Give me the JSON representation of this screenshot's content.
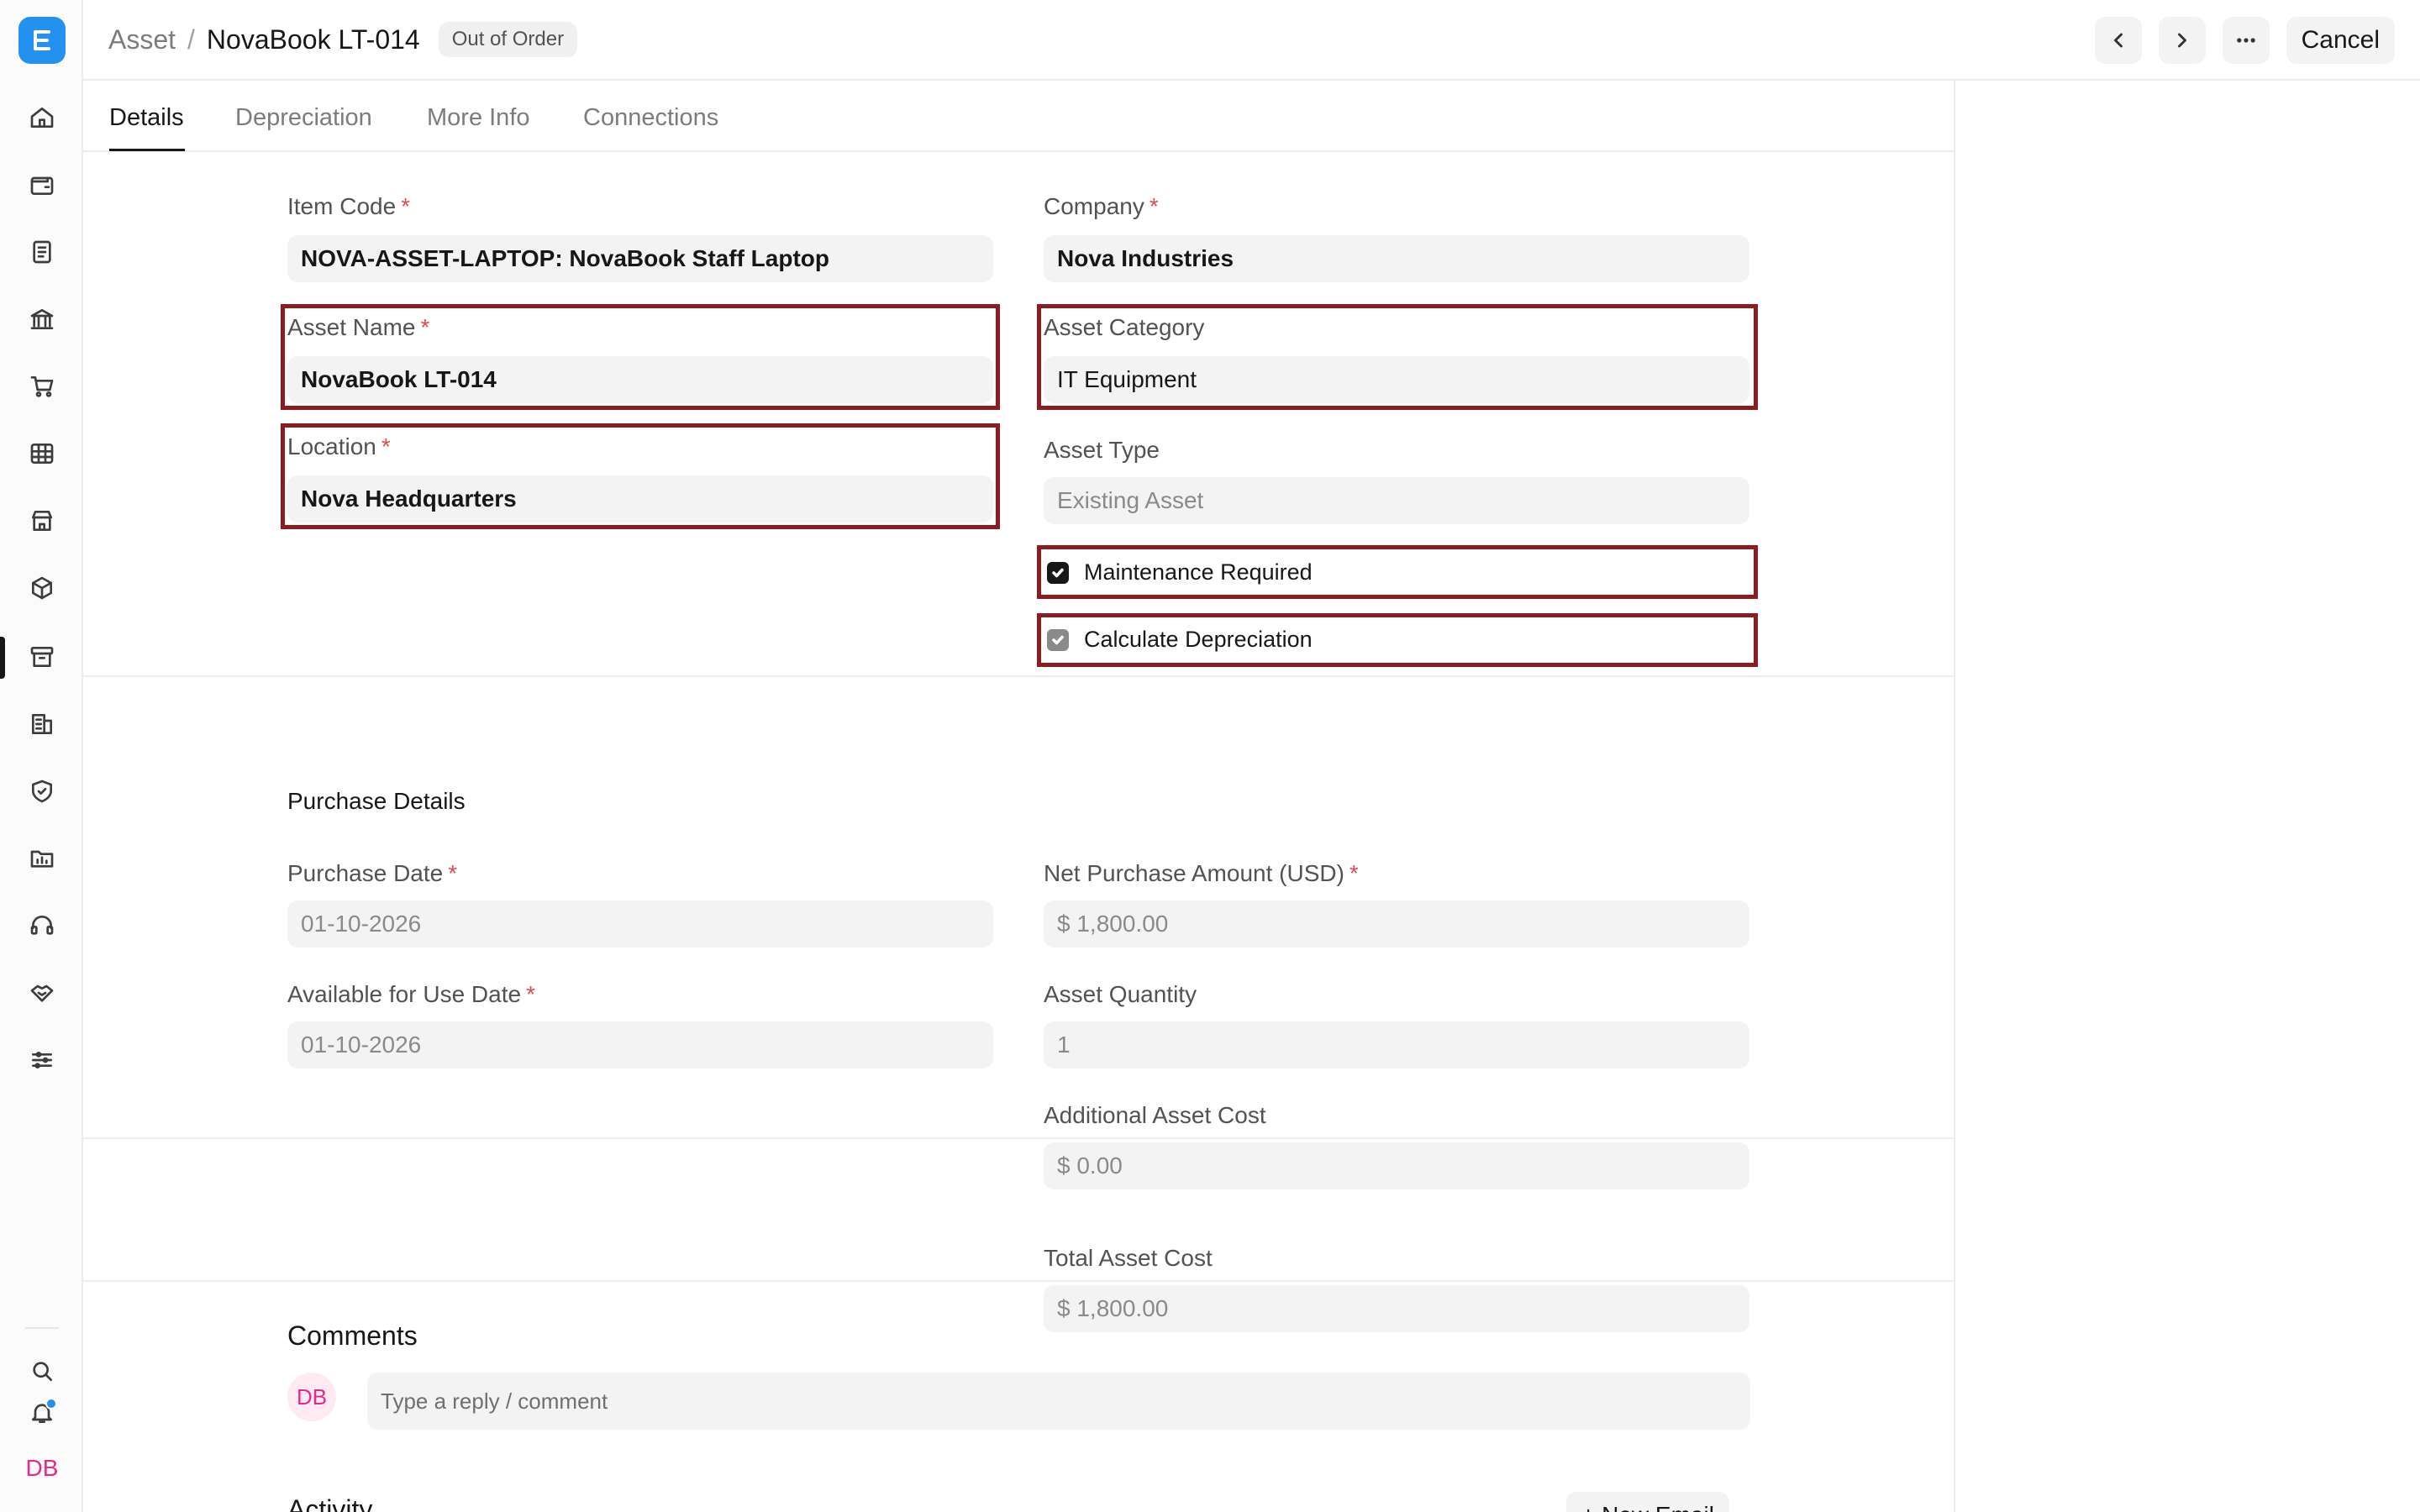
{
  "app": {
    "logo_letter": "E",
    "brand_color": "#2490ef",
    "highlight_color": "#8c1c20"
  },
  "sidebar": {
    "icons": [
      "home-icon",
      "wallet-icon",
      "receipt-icon",
      "bank-icon",
      "cart-icon",
      "grid-icon",
      "store-icon",
      "package-icon",
      "archive-icon",
      "building-icon",
      "shield-icon",
      "folder-chart-icon",
      "headset-icon",
      "handshake-icon",
      "sliders-icon"
    ],
    "active_icon": "archive-icon",
    "bottom_icons": [
      "search-icon",
      "bell-icon"
    ],
    "user_initials": "DB"
  },
  "header": {
    "breadcrumb_parent": "Asset",
    "breadcrumb_separator": "/",
    "title": "NovaBook LT-014",
    "status": "Out of Order",
    "cancel_label": "Cancel"
  },
  "tabs": [
    {
      "label": "Details",
      "active": true
    },
    {
      "label": "Depreciation",
      "active": false
    },
    {
      "label": "More Info",
      "active": false
    },
    {
      "label": "Connections",
      "active": false
    }
  ],
  "form": {
    "item_code": {
      "label": "Item Code",
      "value": "NOVA-ASSET-LAPTOP: NovaBook Staff Laptop"
    },
    "company": {
      "label": "Company",
      "value": "Nova Industries"
    },
    "asset_name": {
      "label": "Asset Name",
      "value": "NovaBook LT-014"
    },
    "asset_category": {
      "label": "Asset Category",
      "value": "IT Equipment"
    },
    "location": {
      "label": "Location",
      "value": "Nova Headquarters"
    },
    "asset_type": {
      "label": "Asset Type",
      "value": "Existing Asset"
    },
    "maintenance_required": {
      "label": "Maintenance Required",
      "checked": true
    },
    "calculate_depreciation": {
      "label": "Calculate Depreciation",
      "checked": true
    }
  },
  "purchase": {
    "section_title": "Purchase Details",
    "purchase_date": {
      "label": "Purchase Date",
      "value": "01-10-2026"
    },
    "net_purchase_amount": {
      "label": "Net Purchase Amount (USD)",
      "value": "$ 1,800.00"
    },
    "available_for_use_date": {
      "label": "Available for Use Date",
      "value": "01-10-2026"
    },
    "asset_quantity": {
      "label": "Asset Quantity",
      "value": "1"
    },
    "additional_asset_cost": {
      "label": "Additional Asset Cost",
      "value": "$ 0.00"
    },
    "total_asset_cost": {
      "label": "Total Asset Cost",
      "value": "$ 1,800.00"
    }
  },
  "comments": {
    "title": "Comments",
    "avatar_initials": "DB",
    "placeholder": "Type a reply / comment"
  },
  "activity": {
    "title": "Activity",
    "new_email_label": "+ New Email"
  },
  "required_mark": "*"
}
